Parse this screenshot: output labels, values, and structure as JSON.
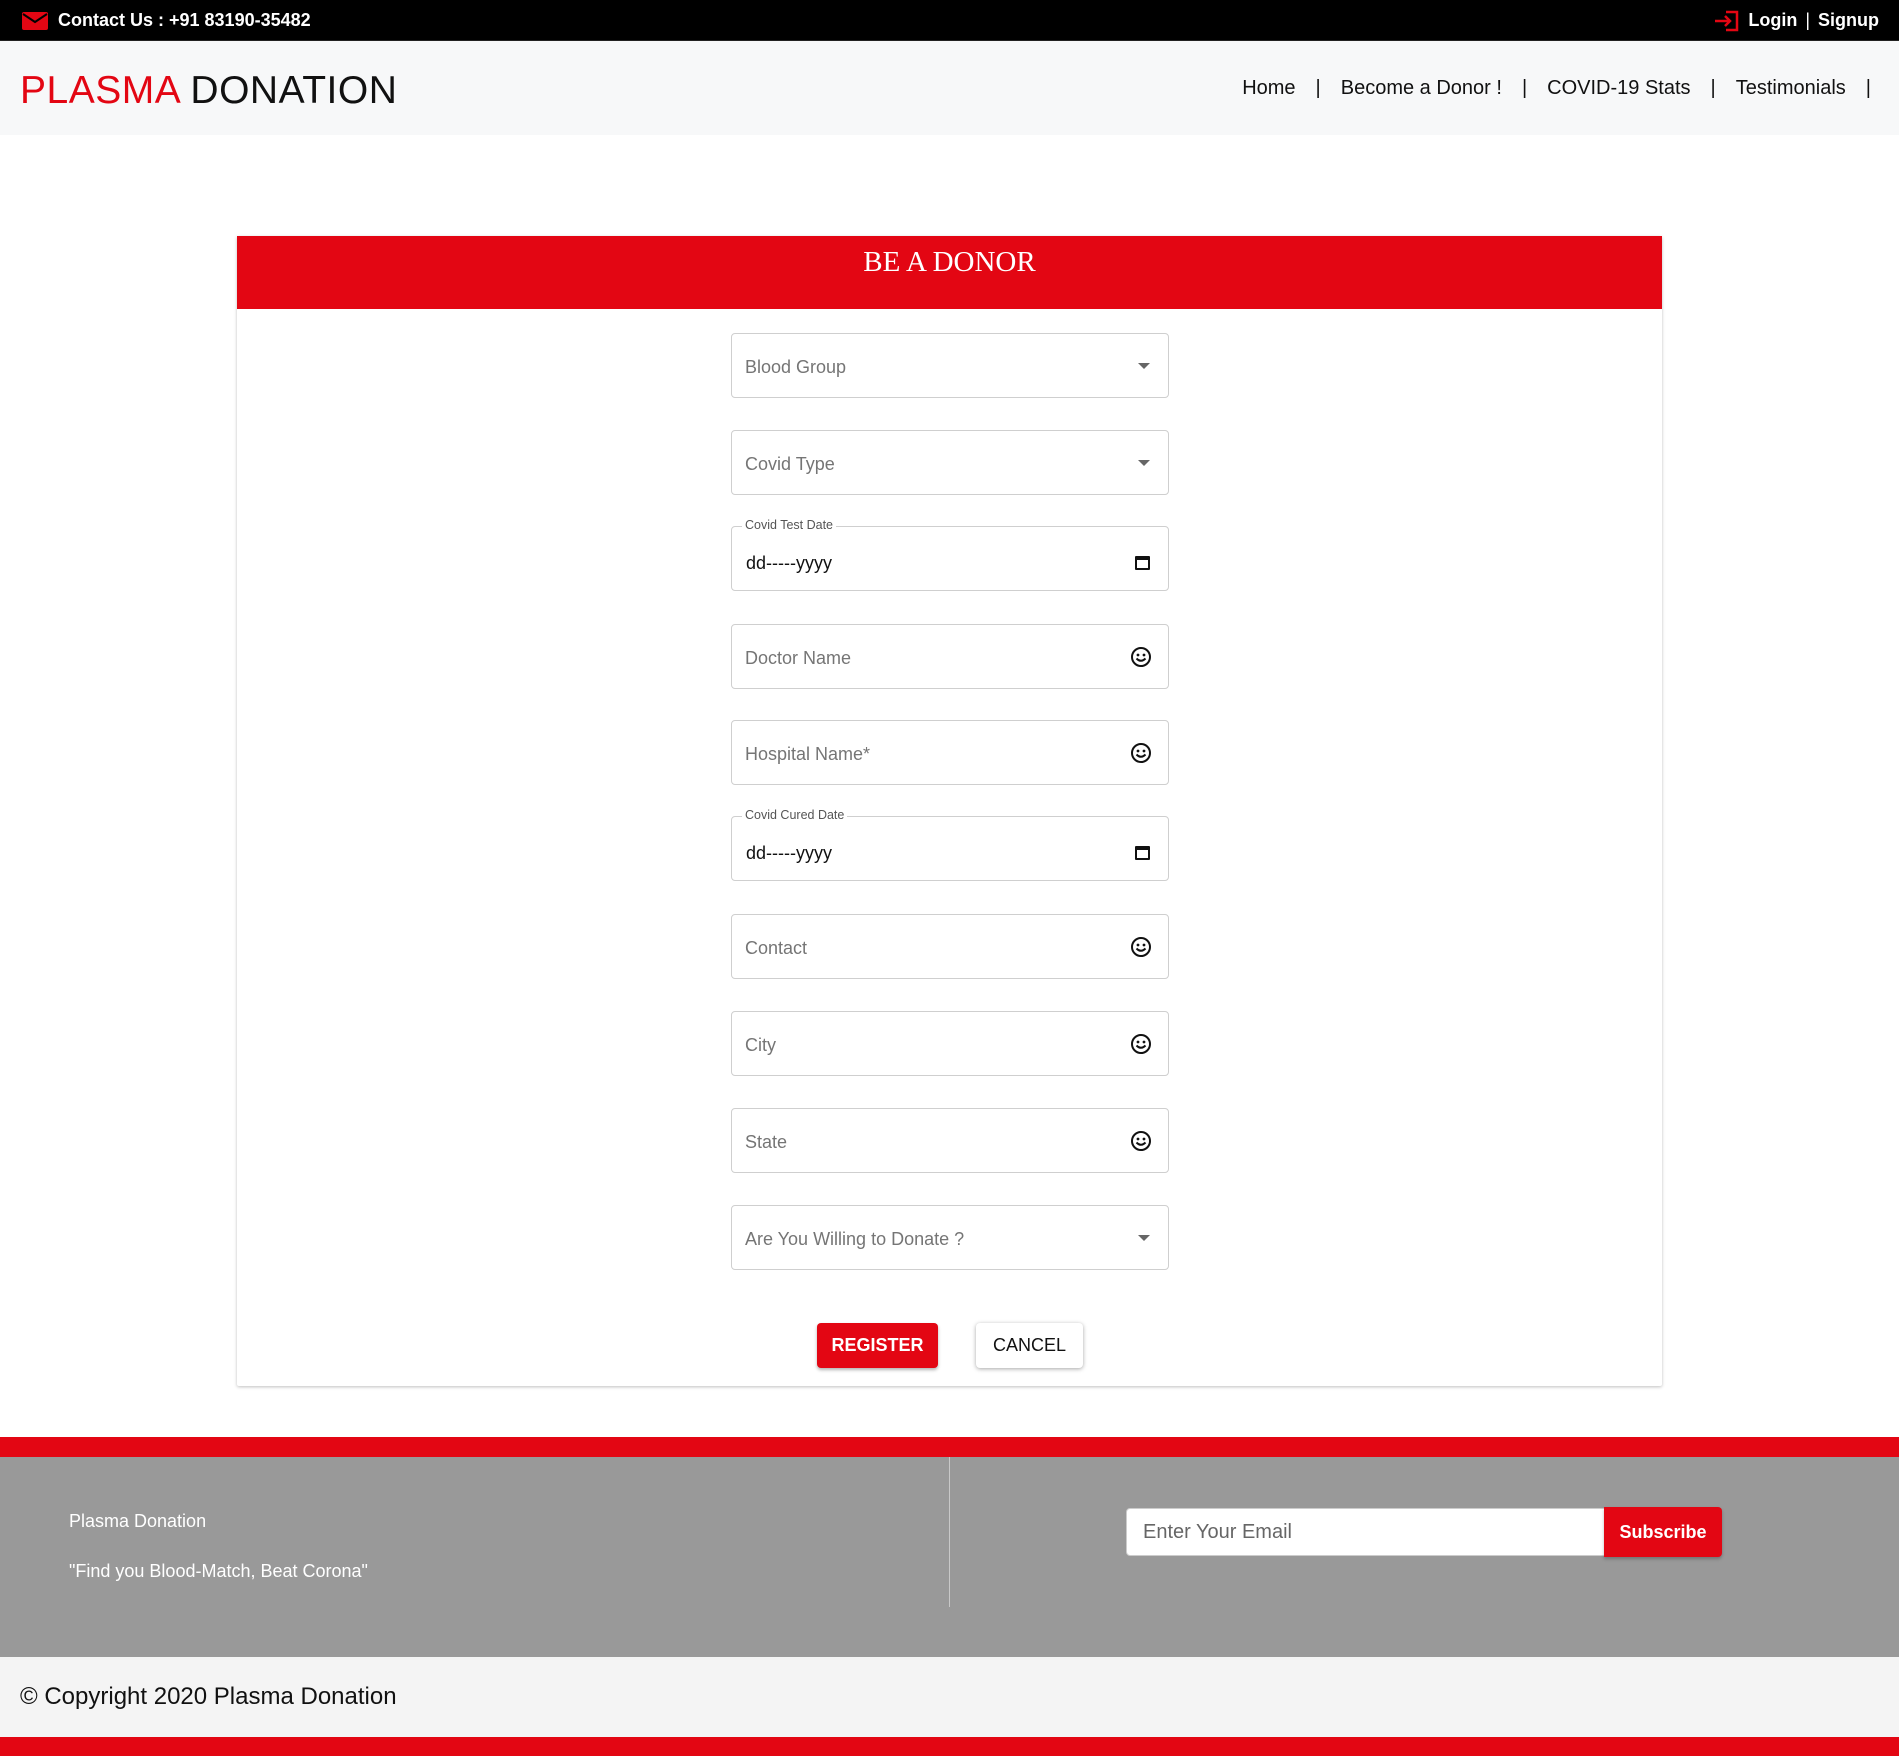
{
  "topbar": {
    "contact_icon": "envelope-icon",
    "contact_text": "Contact Us : +91 83190-35482",
    "login_icon": "login-arrow-icon",
    "login": "Login",
    "separator": "|",
    "signup": "Signup"
  },
  "header": {
    "logo_part1": "PLASMA",
    "logo_part2": "DONATION",
    "nav": [
      {
        "label": "Home"
      },
      {
        "label": "Become a Donor !"
      },
      {
        "label": "COVID-19 Stats"
      },
      {
        "label": "Testimonials"
      }
    ],
    "nav_separator": "|"
  },
  "form": {
    "title": "BE A DONOR",
    "blood_group": "Blood Group",
    "covid_type": "Covid Type",
    "covid_test_date_label": "Covid Test Date",
    "covid_test_date_value": "dd-----yyyy",
    "doctor_name": "Doctor Name",
    "hospital_name": "Hospital Name*",
    "covid_cured_date_label": "Covid Cured Date",
    "covid_cured_date_value": "dd-----yyyy",
    "contact": "Contact",
    "city": "City",
    "state": "State",
    "willing": "Are You Willing to Donate ?",
    "register": "REGISTER",
    "cancel": "CANCEL"
  },
  "footer": {
    "brand": "Plasma Donation",
    "tagline": "\"Find you Blood-Match, Beat Corona\"",
    "email_placeholder": "Enter Your Email",
    "subscribe": "Subscribe",
    "copyright": "© Copyright 2020 Plasma Donation"
  },
  "colors": {
    "brand_red": "#e30613",
    "footer_gray": "#999999",
    "topbar_black": "#000000"
  }
}
